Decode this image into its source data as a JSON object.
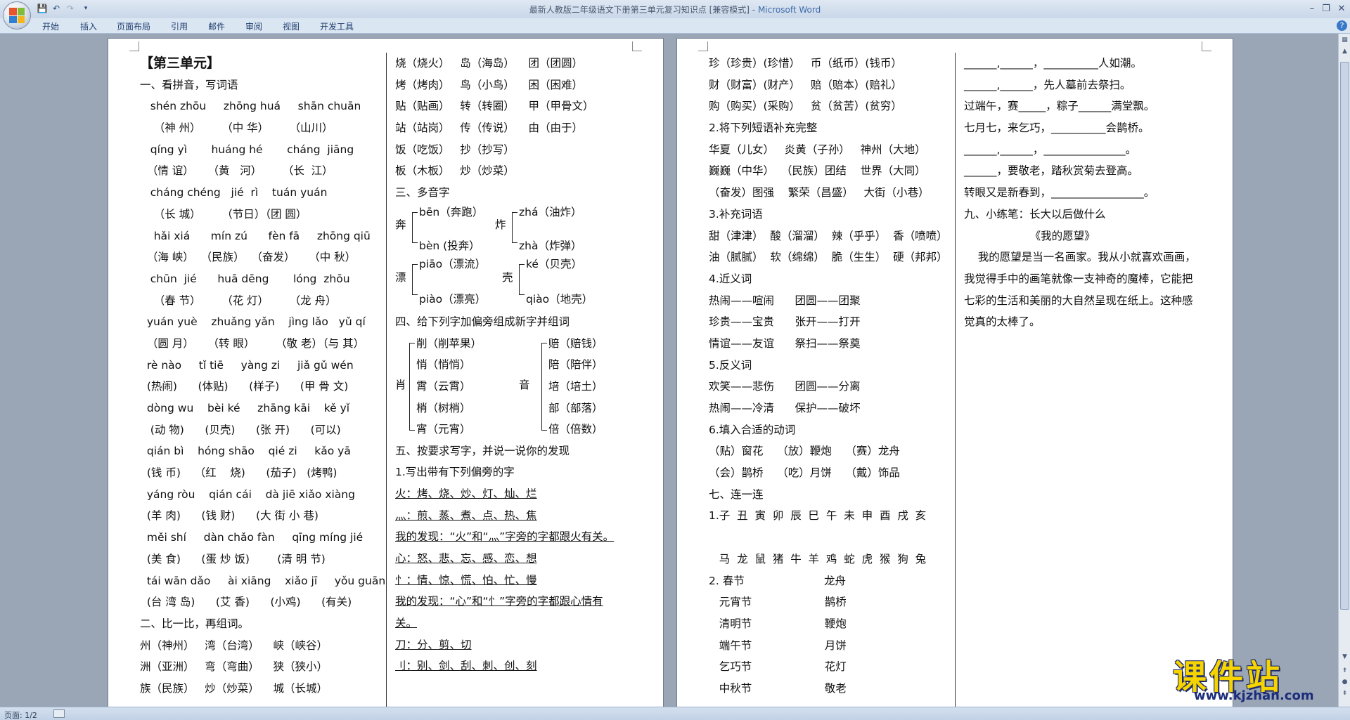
{
  "window": {
    "title": "最新人教版二年级语文下册第三单元复习知识点 [兼容模式]",
    "app_name": "Microsoft Word"
  },
  "ribbon": {
    "tabs": [
      "开始",
      "插入",
      "页面布局",
      "引用",
      "邮件",
      "审阅",
      "视图",
      "开发工具"
    ]
  },
  "status": {
    "page": "页面: 1/2"
  },
  "watermark": {
    "main": "课件站",
    "url": "www.kjzhan.com"
  },
  "page1_col1": [
    "【第三单元】",
    "一、看拼音，写词语",
    "   shén zhōu     zhōng huá     shān chuān",
    "    （神 州）      （中 华）      （山川）",
    "   qíng yì       huáng hé       cháng  jiāng",
    "  （情 谊）    （黄   河）      （长  江）",
    "   cháng chéng   jié  rì    tuán yuán",
    "    （长 城）      （节日）（团 圆）",
    "    hǎi xiá      mín zú      fèn fā     zhōng qiū",
    "  （海 峡）  （民族）  （奋发）    （中 秋）",
    "   chūn  jié      huā dēng       lóng  zhōu",
    "    （春 节）      （花 灯）      （龙 舟）",
    "  yuán yuè    zhuǎng yǎn    jìng lǎo   yǔ qí",
    "  （圆 月）    （转 眼）      （敬 老）（与 其）",
    "  rè nào     tǐ tiē     yàng zi     jiǎ gǔ wén",
    "  (热闹)      (体贴)      (样子)      (甲 骨 文)",
    "  dòng wu    bèi ké     zhāng kāi    kě yǐ",
    "   (动 物)      (贝壳)      (张 开)      (可以)",
    "  qián bì    hóng shāo    qié zi     kǎo yā",
    "  (钱 币)    （红    烧)      (茄子)   (烤鸭)",
    "  yáng ròu    qián cái    dà jiē xiǎo xiàng",
    "  (羊 肉)      (钱 财)      (大 街 小 巷)",
    "  měi shí     dàn chǎo fàn     qīng míng jié",
    "  (美 食)      (蛋 炒 饭)        (清 明 节)",
    "  tái wān dǎo     ài xiāng    xiǎo jī     yǒu guān",
    "  (台 湾 岛)      (艾 香)      (小鸡)      (有关)",
    "二、比一比，再组词。",
    "州（神州）   湾（台湾）    峡（峡谷）",
    "洲（亚洲）   弯（弯曲）    狭（狭小）",
    "族（民族）   炒（炒菜）    城（长城）"
  ],
  "page1_col2": {
    "pairs": [
      "烧（烧火）   岛（海岛）    团（团圆）",
      "烤（烤肉）   鸟（小鸟）    困（困难）",
      "贴（贴画）   转（转圈）    甲（甲骨文）",
      "站（站岗）   传（传说）    由（由于）",
      "饭（吃饭）   抄（抄写）",
      "板（木板）   炒（炒菜）"
    ],
    "section3": "三、多音字",
    "polyphones": [
      {
        "char": "奔",
        "r1": "bēn（奔跑）",
        "r2": "bèn (投奔）"
      },
      {
        "char": "炸",
        "r1": "zhá（油炸）",
        "r2": "zhà（炸弹）"
      },
      {
        "char": "漂",
        "r1": "piāo（漂流）",
        "r2": "piào（漂亮）"
      },
      {
        "char": "壳",
        "r1": "ké（贝壳）",
        "r2": "qiào（地壳）"
      }
    ],
    "section4": "四、给下列字加偏旁组成新字并组词",
    "radical_left": {
      "char": "肖",
      "items": [
        "削（削苹果）",
        "悄（悄悄）",
        "霄（云霄）",
        "梢（树梢）",
        "宵（元宵）"
      ]
    },
    "radical_right": {
      "char": "音",
      "items": [
        "赔（赔钱）",
        "陪（陪伴）",
        "培（培土）",
        "部（部落）",
        "倍（倍数）"
      ]
    },
    "section5": "五、按要求写字，并说一说你的发现",
    "s5_lines": [
      "1.写出带有下列偏旁的字",
      "火：烤、烧、炒、灯、灿、烂",
      "灬：煎、蒸、煮、点、热、焦",
      "我的发现：“火”和“灬”字旁的字都跟火有关。",
      "心：怒、悲、忘、感、恋、想",
      "忄：情、惊、慌、怕、忙、慢",
      "我的发现：“心”和“忄”字旁的字都跟心情有",
      "关。",
      "刀：分、剪、切",
      "刂：别、剑、刮、刺、创、刻"
    ]
  },
  "page2_col1": [
    "珍（珍贵）(珍惜）   币（纸币）(钱币）",
    "财（财富）(财产）   赔（赔本）(赔礼）",
    "购（购买）(采购）   贫（贫苦）(贫穷）",
    "2.将下列短语补充完整",
    "华夏（儿女）   炎黄（子孙）   神州（大地）",
    "巍巍（中华）  （民族）团结    世界（大同）",
    "（奋发）图强    繁荣（昌盛）   大街（小巷）",
    "3.补充词语",
    "甜（津津）  酸（溜溜）  辣（乎乎）  香（喷喷）",
    "油（腻腻）  软（绵绵）  脆（生生）  硬（邦邦）",
    "4.近义词",
    "热闹——喧闹      团圆——团聚",
    "珍贵——宝贵      张开——打开",
    "情谊——友谊      祭扫——祭奠",
    "5.反义词",
    "欢笑——悲伤      团圆——分离",
    "热闹——冷清      保护——破坏",
    "6.填入合适的动词",
    "（贴）窗花    （放）鞭炮    （赛）龙舟",
    "（会）鹊桥    （吃）月饼    （戴）饰品",
    "七、连一连",
    "1.子  丑  寅  卯  辰  巳  午  未  申  酉  戌  亥",
    "",
    "   马  龙  鼠  猪  牛  羊  鸡  蛇  虎  猴  狗  兔",
    "2. 春节                       龙舟",
    "   元宵节                     鹊桥",
    "   清明节                     鞭炮",
    "   端午节                     月饼",
    "   乞巧节                     花灯",
    "   中秋节                     敬老"
  ],
  "page2_col2": [
    "______,______，__________人如潮。",
    "______,______，先人墓前去祭扫。",
    "过端午，赛_____，粽子______满堂飘。",
    "七月七，来乞巧，__________会鹊桥。",
    "______,______，_______________。",
    "______，要敬老，踏秋赏菊去登高。",
    "转眼又是新春到，_________________。",
    "九、小练笔：长大以后做什么",
    "                   《我的愿望》",
    "    我的愿望是当一名画家。我从小就喜欢画画，",
    "我觉得手中的画笔就像一支神奇的魔棒，它能把",
    "七彩的生活和美丽的大自然呈现在纸上。这种感",
    "觉真的太棒了。"
  ]
}
